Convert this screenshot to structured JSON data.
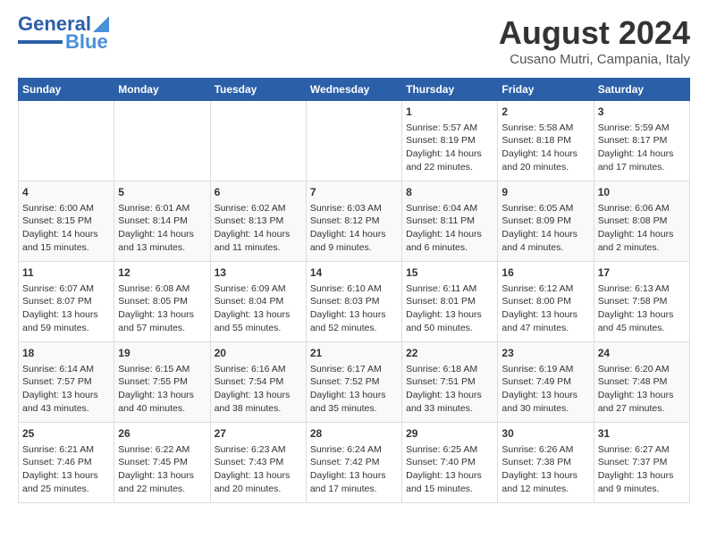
{
  "header": {
    "logo_line1": "General",
    "logo_line2": "Blue",
    "main_title": "August 2024",
    "subtitle": "Cusano Mutri, Campania, Italy"
  },
  "weekdays": [
    "Sunday",
    "Monday",
    "Tuesday",
    "Wednesday",
    "Thursday",
    "Friday",
    "Saturday"
  ],
  "weeks": [
    [
      {
        "day": "",
        "text": ""
      },
      {
        "day": "",
        "text": ""
      },
      {
        "day": "",
        "text": ""
      },
      {
        "day": "",
        "text": ""
      },
      {
        "day": "1",
        "text": "Sunrise: 5:57 AM\nSunset: 8:19 PM\nDaylight: 14 hours\nand 22 minutes."
      },
      {
        "day": "2",
        "text": "Sunrise: 5:58 AM\nSunset: 8:18 PM\nDaylight: 14 hours\nand 20 minutes."
      },
      {
        "day": "3",
        "text": "Sunrise: 5:59 AM\nSunset: 8:17 PM\nDaylight: 14 hours\nand 17 minutes."
      }
    ],
    [
      {
        "day": "4",
        "text": "Sunrise: 6:00 AM\nSunset: 8:15 PM\nDaylight: 14 hours\nand 15 minutes."
      },
      {
        "day": "5",
        "text": "Sunrise: 6:01 AM\nSunset: 8:14 PM\nDaylight: 14 hours\nand 13 minutes."
      },
      {
        "day": "6",
        "text": "Sunrise: 6:02 AM\nSunset: 8:13 PM\nDaylight: 14 hours\nand 11 minutes."
      },
      {
        "day": "7",
        "text": "Sunrise: 6:03 AM\nSunset: 8:12 PM\nDaylight: 14 hours\nand 9 minutes."
      },
      {
        "day": "8",
        "text": "Sunrise: 6:04 AM\nSunset: 8:11 PM\nDaylight: 14 hours\nand 6 minutes."
      },
      {
        "day": "9",
        "text": "Sunrise: 6:05 AM\nSunset: 8:09 PM\nDaylight: 14 hours\nand 4 minutes."
      },
      {
        "day": "10",
        "text": "Sunrise: 6:06 AM\nSunset: 8:08 PM\nDaylight: 14 hours\nand 2 minutes."
      }
    ],
    [
      {
        "day": "11",
        "text": "Sunrise: 6:07 AM\nSunset: 8:07 PM\nDaylight: 13 hours\nand 59 minutes."
      },
      {
        "day": "12",
        "text": "Sunrise: 6:08 AM\nSunset: 8:05 PM\nDaylight: 13 hours\nand 57 minutes."
      },
      {
        "day": "13",
        "text": "Sunrise: 6:09 AM\nSunset: 8:04 PM\nDaylight: 13 hours\nand 55 minutes."
      },
      {
        "day": "14",
        "text": "Sunrise: 6:10 AM\nSunset: 8:03 PM\nDaylight: 13 hours\nand 52 minutes."
      },
      {
        "day": "15",
        "text": "Sunrise: 6:11 AM\nSunset: 8:01 PM\nDaylight: 13 hours\nand 50 minutes."
      },
      {
        "day": "16",
        "text": "Sunrise: 6:12 AM\nSunset: 8:00 PM\nDaylight: 13 hours\nand 47 minutes."
      },
      {
        "day": "17",
        "text": "Sunrise: 6:13 AM\nSunset: 7:58 PM\nDaylight: 13 hours\nand 45 minutes."
      }
    ],
    [
      {
        "day": "18",
        "text": "Sunrise: 6:14 AM\nSunset: 7:57 PM\nDaylight: 13 hours\nand 43 minutes."
      },
      {
        "day": "19",
        "text": "Sunrise: 6:15 AM\nSunset: 7:55 PM\nDaylight: 13 hours\nand 40 minutes."
      },
      {
        "day": "20",
        "text": "Sunrise: 6:16 AM\nSunset: 7:54 PM\nDaylight: 13 hours\nand 38 minutes."
      },
      {
        "day": "21",
        "text": "Sunrise: 6:17 AM\nSunset: 7:52 PM\nDaylight: 13 hours\nand 35 minutes."
      },
      {
        "day": "22",
        "text": "Sunrise: 6:18 AM\nSunset: 7:51 PM\nDaylight: 13 hours\nand 33 minutes."
      },
      {
        "day": "23",
        "text": "Sunrise: 6:19 AM\nSunset: 7:49 PM\nDaylight: 13 hours\nand 30 minutes."
      },
      {
        "day": "24",
        "text": "Sunrise: 6:20 AM\nSunset: 7:48 PM\nDaylight: 13 hours\nand 27 minutes."
      }
    ],
    [
      {
        "day": "25",
        "text": "Sunrise: 6:21 AM\nSunset: 7:46 PM\nDaylight: 13 hours\nand 25 minutes."
      },
      {
        "day": "26",
        "text": "Sunrise: 6:22 AM\nSunset: 7:45 PM\nDaylight: 13 hours\nand 22 minutes."
      },
      {
        "day": "27",
        "text": "Sunrise: 6:23 AM\nSunset: 7:43 PM\nDaylight: 13 hours\nand 20 minutes."
      },
      {
        "day": "28",
        "text": "Sunrise: 6:24 AM\nSunset: 7:42 PM\nDaylight: 13 hours\nand 17 minutes."
      },
      {
        "day": "29",
        "text": "Sunrise: 6:25 AM\nSunset: 7:40 PM\nDaylight: 13 hours\nand 15 minutes."
      },
      {
        "day": "30",
        "text": "Sunrise: 6:26 AM\nSunset: 7:38 PM\nDaylight: 13 hours\nand 12 minutes."
      },
      {
        "day": "31",
        "text": "Sunrise: 6:27 AM\nSunset: 7:37 PM\nDaylight: 13 hours\nand 9 minutes."
      }
    ]
  ]
}
